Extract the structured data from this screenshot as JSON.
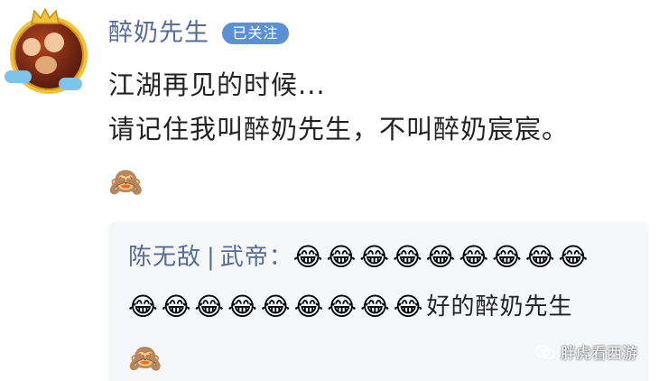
{
  "post": {
    "username": "醉奶先生",
    "follow_badge": "已关注",
    "avatar_icon": "cartoon-avatar-icon",
    "body_line1": "江湖再见的时候...",
    "body_line2": "请记住我叫醉奶先生，不叫醉奶宸宸。",
    "body_emoji": "🙈"
  },
  "reply": {
    "author": "陈无敌",
    "separator": "|",
    "author_title": "武帝：",
    "emojis_line1": "😂😂😂😂😂😂😂😂😂",
    "emojis_line2": "😂😂😂😂😂😂😂😂😂",
    "text": "好的醉奶先生",
    "trailing_emoji": "🙈"
  },
  "watermark": {
    "text": "胖虎看西游",
    "icon": "wechat-icon"
  }
}
